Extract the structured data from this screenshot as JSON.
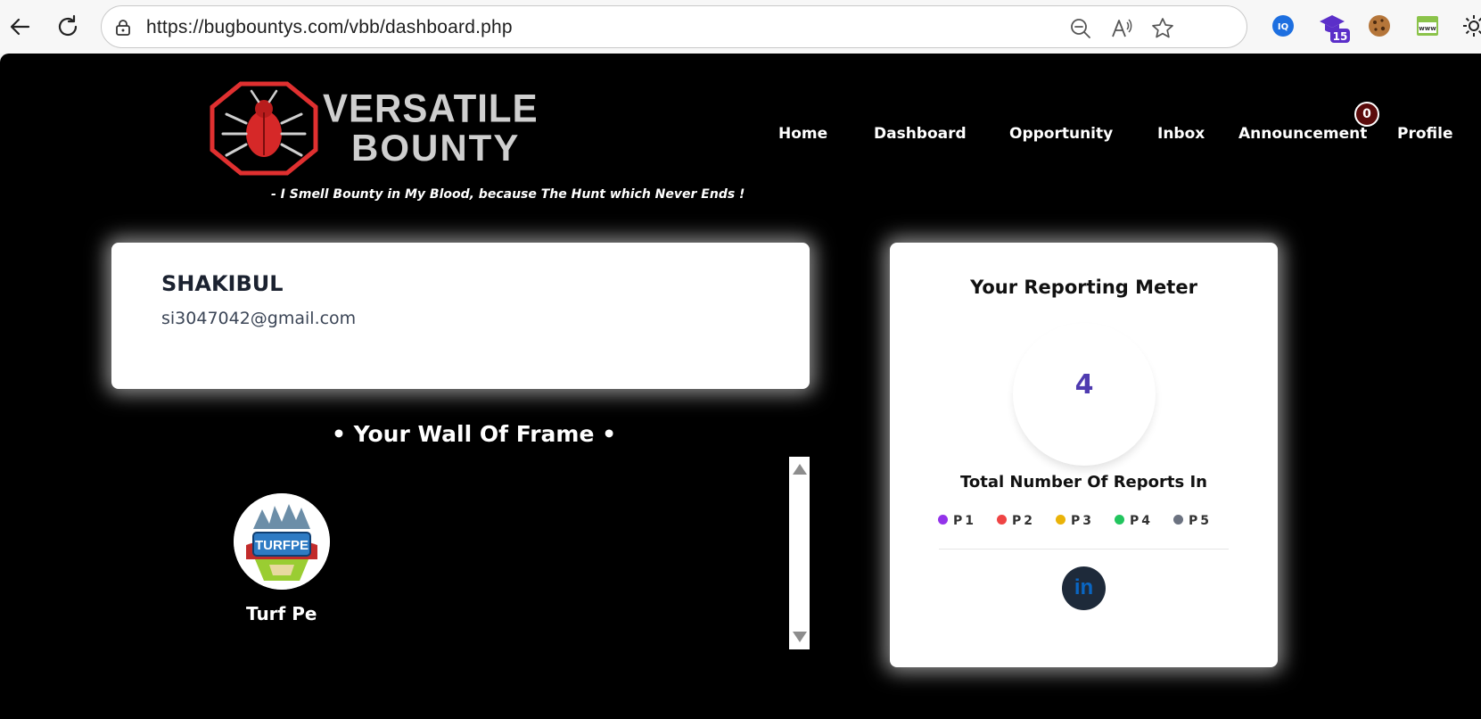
{
  "browser": {
    "url": "https://bugbountys.com/vbb/dashboard.php",
    "extension_badge": "15"
  },
  "brand": {
    "line1": "VERSATILE",
    "line2": "BOUNTY",
    "tagline": "- I Smell Bounty in My Blood, because The Hunt which Never Ends !",
    "accent_color": "#e03030"
  },
  "nav": {
    "items": [
      {
        "label": "Home"
      },
      {
        "label": "Dashboard"
      },
      {
        "label": "Opportunity"
      },
      {
        "label": "Inbox"
      },
      {
        "label": "Announcement"
      },
      {
        "label": "Profile"
      }
    ],
    "announcement_count": "0"
  },
  "profile": {
    "name": "SHAKIBUL",
    "email": "si3047042@gmail.com"
  },
  "wall": {
    "title": "• Your Wall Of Frame •",
    "companies": [
      {
        "name": "Turf Pe",
        "logo_text": "TURFPE"
      }
    ]
  },
  "meter": {
    "title": "Your Reporting Meter",
    "count": "4",
    "subtitle": "Total Number Of Reports In",
    "legend": [
      {
        "label": "P1",
        "color": "#9333ea"
      },
      {
        "label": "P2",
        "color": "#ef4444"
      },
      {
        "label": "P3",
        "color": "#eab308"
      },
      {
        "label": "P4",
        "color": "#22c55e"
      },
      {
        "label": "P5",
        "color": "#6b7280"
      }
    ],
    "social_icon": "linkedin-icon",
    "social_label": "in"
  }
}
